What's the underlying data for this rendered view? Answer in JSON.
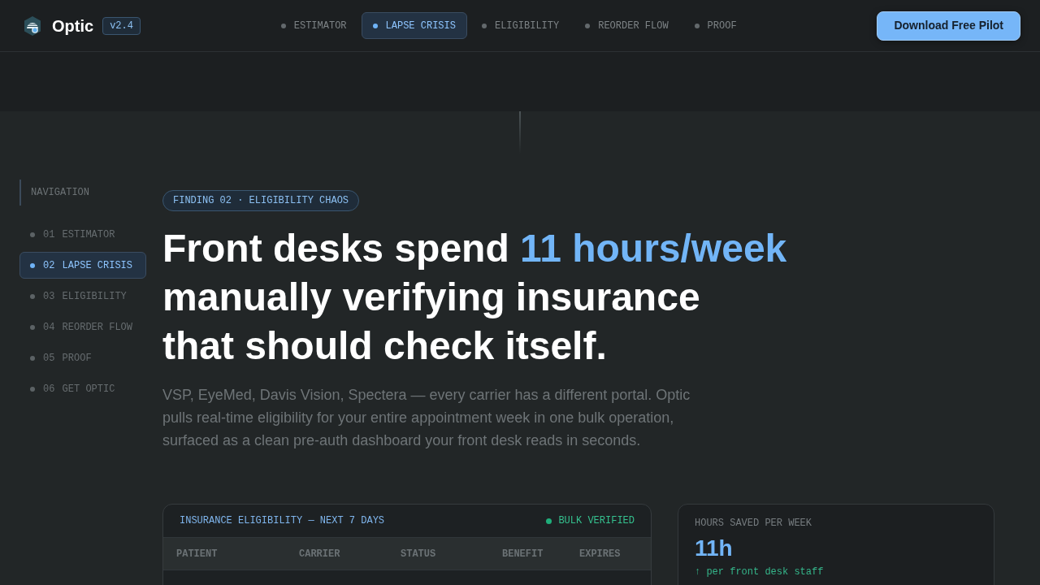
{
  "header": {
    "brand": "Optic",
    "version": "v2.4",
    "tabs": [
      {
        "label": "ESTIMATOR",
        "selected": false
      },
      {
        "label": "LAPSE CRISIS",
        "selected": true
      },
      {
        "label": "ELIGIBILITY",
        "selected": false
      },
      {
        "label": "REORDER FLOW",
        "selected": false
      },
      {
        "label": "PROOF",
        "selected": false
      }
    ],
    "cta": "Download Free Pilot"
  },
  "sidebar": {
    "title": "NAVIGATION",
    "items": [
      {
        "number": "01",
        "label": "ESTIMATOR",
        "selected": false
      },
      {
        "number": "02",
        "label": "LAPSE CRISIS",
        "selected": true
      },
      {
        "number": "03",
        "label": "ELIGIBILITY",
        "selected": false
      },
      {
        "number": "04",
        "label": "REORDER FLOW",
        "selected": false
      },
      {
        "number": "05",
        "label": "PROOF",
        "selected": false
      },
      {
        "number": "06",
        "label": "GET OPTIC",
        "selected": false
      }
    ]
  },
  "hero": {
    "badge": "FINDING 02 · ELIGIBILITY CHAOS",
    "heading": {
      "lead": "Front desks spend",
      "highlight": "11 hours/week",
      "lines": [
        "manually verifying insurance",
        "that should check itself."
      ]
    },
    "paragraph": "VSP, EyeMed, Davis Vision, Spectera — every carrier has a different portal. Optic pulls real-time eligibility for your entire appointment week in one bulk operation, surfaced as a clean pre-auth dashboard your front desk reads in seconds."
  },
  "eligibility_table": {
    "title": "INSURANCE ELIGIBILITY — NEXT 7 DAYS",
    "status": "BULK VERIFIED",
    "columns": [
      "PATIENT",
      "CARRIER",
      "STATUS",
      "BENEFIT",
      "EXPIRES"
    ]
  },
  "stat_card": {
    "label": "HOURS SAVED PER WEEK",
    "value": "11h",
    "note": "↑ per front desk staff"
  }
}
